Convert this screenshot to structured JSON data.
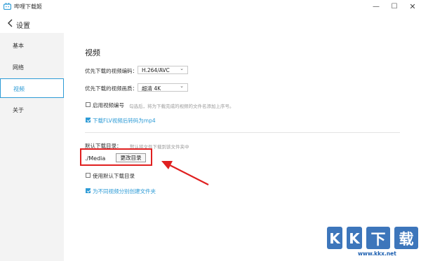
{
  "window": {
    "title": "哔哩下载姬",
    "controls": {
      "minimize": "—",
      "maximize": "☐",
      "close": "✕"
    }
  },
  "header": {
    "title": "设置"
  },
  "sidebar": {
    "items": [
      {
        "label": "基本",
        "active": false
      },
      {
        "label": "网络",
        "active": false
      },
      {
        "label": "视频",
        "active": true
      },
      {
        "label": "关于",
        "active": false
      }
    ]
  },
  "video_settings": {
    "section_title": "视频",
    "codec": {
      "label": "优先下载的视频编码：",
      "value": "H.264/AVC"
    },
    "quality": {
      "label": "优先下载的视频画质：",
      "value": "超清 4K"
    },
    "numbering": {
      "label": "启用视频编号",
      "hint": "勾选后，将为下载完成的视频的文件名添加上序号。",
      "checked": false
    },
    "flv_to_mp4": {
      "label": "下载FLV视频后转码为mp4",
      "checked": true
    },
    "download_dir": {
      "label": "默认下载目录：",
      "hint": "默认将文件下载到该文件夹中",
      "path": "./Media",
      "change_button": "更改目录"
    },
    "use_default_dir": {
      "label": "使用默认下载目录",
      "checked": false
    },
    "create_folder": {
      "label": "为不同视频分别创建文件夹",
      "checked": true
    }
  },
  "watermark": {
    "site": "www.kkx.net"
  },
  "colors": {
    "accent": "#2d9bd6",
    "highlight": "#e02020",
    "sidebar_bg": "#f3f3f3"
  }
}
